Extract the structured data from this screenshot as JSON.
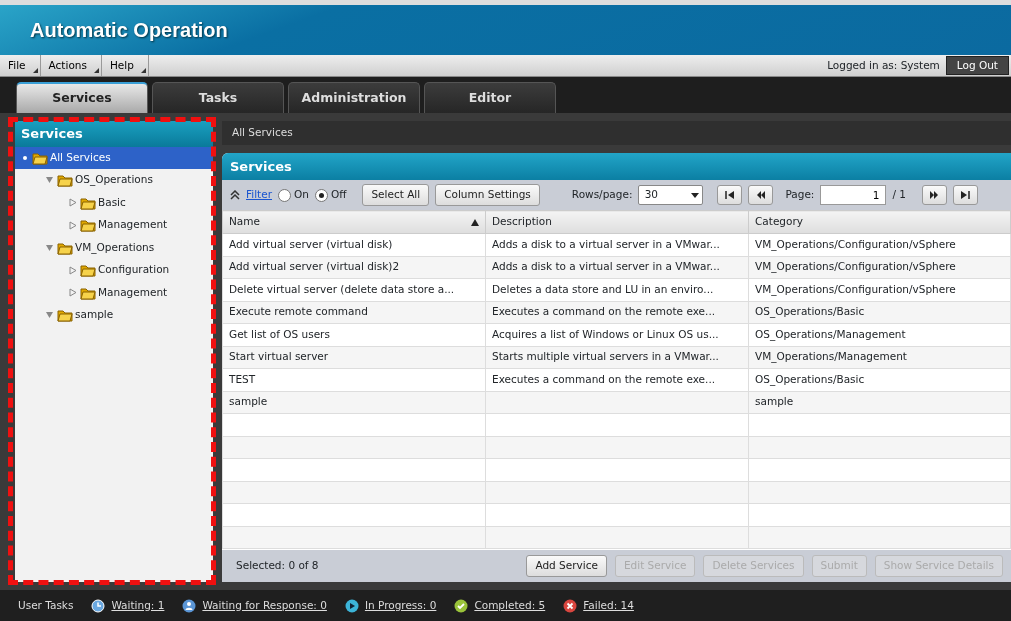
{
  "app_title": "Automatic Operation",
  "menu": [
    "File",
    "Actions",
    "Help"
  ],
  "login": {
    "label": "Logged in as: System",
    "logout": "Log Out"
  },
  "tabs": [
    {
      "label": "Services",
      "selected": true
    },
    {
      "label": "Tasks",
      "selected": false
    },
    {
      "label": "Administration",
      "selected": false
    },
    {
      "label": "Editor",
      "selected": false
    }
  ],
  "sidebar": {
    "title": "Services",
    "tree": [
      {
        "label": "All Services",
        "selected": true,
        "children": [
          {
            "label": "OS_Operations",
            "selected": false,
            "expanded": true,
            "children": [
              {
                "label": "Basic",
                "selected": false,
                "expanded": false
              },
              {
                "label": "Management",
                "selected": false,
                "expanded": false
              }
            ]
          },
          {
            "label": "VM_Operations",
            "selected": false,
            "expanded": true,
            "children": [
              {
                "label": "Configuration",
                "selected": false,
                "expanded": false
              },
              {
                "label": "Management",
                "selected": false,
                "expanded": false
              }
            ]
          },
          {
            "label": "sample",
            "selected": false,
            "expanded": true
          }
        ]
      }
    ]
  },
  "breadcrumb": "All Services",
  "panel": {
    "title": "Services",
    "toolbar": {
      "filter": "Filter",
      "radios": [
        {
          "label": "On",
          "selected": false
        },
        {
          "label": "Off",
          "selected": true
        }
      ],
      "buttons": [
        "Select All",
        "Column Settings"
      ],
      "rows_label": "Rows/page:",
      "rows_value": "30",
      "page_label": "Page:",
      "page_value": "1",
      "page_total": "/ 1"
    },
    "table": {
      "columns": [
        {
          "label": "Name",
          "sorted": true
        },
        {
          "label": "Description",
          "sorted": false
        },
        {
          "label": "Category",
          "sorted": false
        }
      ],
      "rows": [
        [
          "Add virtual server (virtual disk)",
          "Adds a disk to a virtual server in a VMwar...",
          "VM_Operations/Configuration/vSphere"
        ],
        [
          "Add virtual server (virtual disk)2",
          "Adds a disk to a virtual server in a VMwar...",
          "VM_Operations/Configuration/vSphere"
        ],
        [
          "Delete virtual server (delete data store a...",
          "Deletes a data store and LU in an enviro...",
          "VM_Operations/Configuration/vSphere"
        ],
        [
          "Execute remote command",
          "Executes a command on the remote exe...",
          "OS_Operations/Basic"
        ],
        [
          "Get list of OS users",
          "Acquires a list of Windows or Linux OS us...",
          "OS_Operations/Management"
        ],
        [
          "Start virtual server",
          "Starts multiple virtual servers in a VMwar...",
          "VM_Operations/Management"
        ],
        [
          "TEST",
          "Executes a command on the remote exe...",
          "OS_Operations/Basic"
        ],
        [
          "sample",
          "",
          "sample"
        ]
      ]
    },
    "selected_count": "Selected: 0 of 8",
    "actions": [
      {
        "label": "Add Service",
        "disabled": false
      },
      {
        "label": "Edit Service",
        "disabled": true
      },
      {
        "label": "Delete Services",
        "disabled": true
      },
      {
        "label": "Submit",
        "disabled": true
      },
      {
        "label": "Show Service Details",
        "disabled": true
      }
    ]
  },
  "status_bar": {
    "label": "User Tasks",
    "items": [
      {
        "kind": "waiting",
        "text": "Waiting: 1"
      },
      {
        "kind": "response",
        "text": "Waiting for Response: 0"
      },
      {
        "kind": "progress",
        "text": "In Progress: 0"
      },
      {
        "kind": "completed",
        "text": "Completed: 5"
      },
      {
        "kind": "failed",
        "text": "Failed: 14"
      }
    ]
  }
}
